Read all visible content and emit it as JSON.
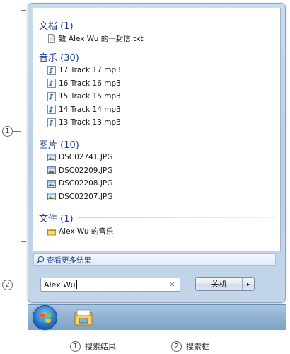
{
  "search_results": {
    "groups": [
      {
        "title": "文档 (1)",
        "items": [
          {
            "label": "致 Alex Wu 的一封信.txt",
            "icon": "text-document-icon"
          }
        ]
      },
      {
        "title": "音乐 (30)",
        "items": [
          {
            "label": "17 Track 17.mp3",
            "icon": "music-file-icon"
          },
          {
            "label": "16 Track 16.mp3",
            "icon": "music-file-icon"
          },
          {
            "label": "15 Track 15.mp3",
            "icon": "music-file-icon"
          },
          {
            "label": "14 Track 14.mp3",
            "icon": "music-file-icon"
          },
          {
            "label": "13 Track 13.mp3",
            "icon": "music-file-icon"
          }
        ]
      },
      {
        "title": "图片 (10)",
        "items": [
          {
            "label": "DSC02741.JPG",
            "icon": "image-file-icon"
          },
          {
            "label": "DSC02209.JPG",
            "icon": "image-file-icon"
          },
          {
            "label": "DSC02208.JPG",
            "icon": "image-file-icon"
          },
          {
            "label": "DSC02207.JPG",
            "icon": "image-file-icon"
          }
        ]
      },
      {
        "title": "文件 (1)",
        "items": [
          {
            "label": "Alex Wu 的音乐",
            "icon": "folder-icon"
          }
        ]
      }
    ]
  },
  "see_more": {
    "label": "查看更多结果",
    "icon": "search-icon"
  },
  "search_box": {
    "value": "Alex Wu",
    "clear_glyph": "×"
  },
  "shutdown": {
    "label": "关机",
    "arrow_glyph": "▸"
  },
  "taskbar": {
    "start_icon": "windows-orb-icon",
    "pinned_icon": "windows-explorer-icon"
  },
  "callouts": [
    {
      "number": "1",
      "label": "搜索结果"
    },
    {
      "number": "2",
      "label": "搜索框"
    }
  ],
  "colors": {
    "group_title": "#1e3f8c",
    "accent": "#2b79c4"
  }
}
